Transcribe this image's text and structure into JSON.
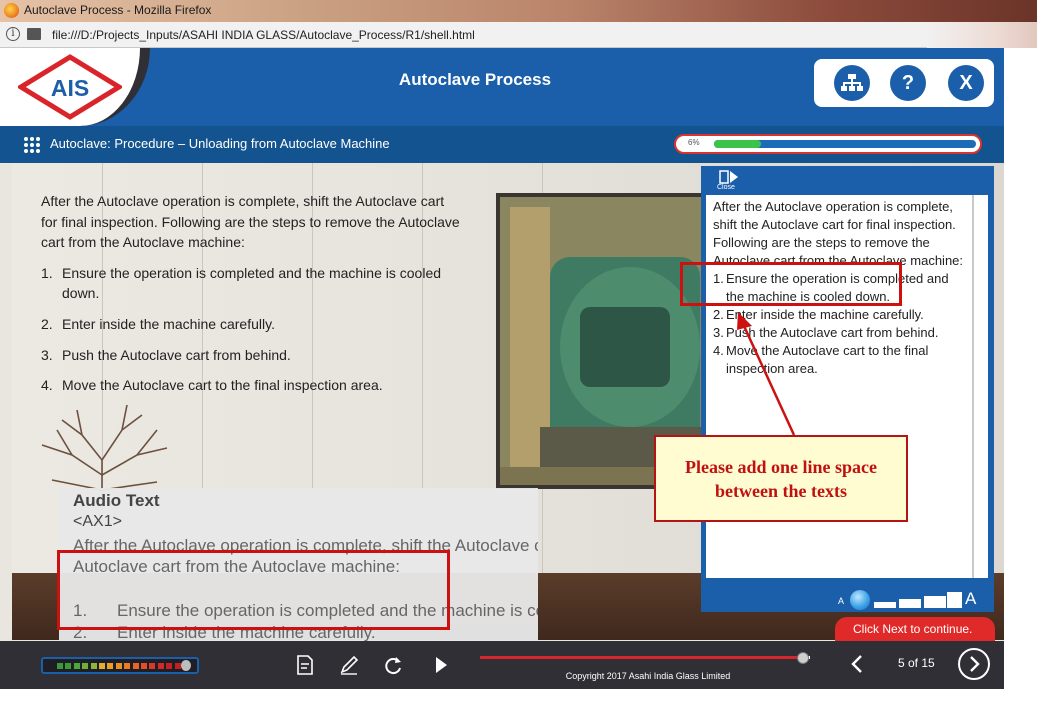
{
  "browser": {
    "window_title": "Autoclave Process - Mozilla Firefox",
    "url": "file:///D:/Projects_Inputs/ASAHI INDIA GLASS/Autoclave_Process/R1/shell.html"
  },
  "header": {
    "logo_text": "AIS",
    "title": "Autoclave Process",
    "close_label": "X",
    "help_label": "?"
  },
  "subheader": {
    "title": "Autoclave: Procedure – Unloading from Autoclave Machine",
    "progress_label": "6%",
    "progress_value": 0.06
  },
  "content": {
    "intro": "After the Autoclave operation is complete, shift the Autoclave cart for final inspection. Following are the steps to remove the Autoclave cart from the Autoclave machine:",
    "steps": [
      {
        "num": "1.",
        "text": "Ensure the operation is completed and the machine is cooled down."
      },
      {
        "num": "2.",
        "text": "Enter inside the machine carefully."
      },
      {
        "num": "3.",
        "text": "Push the Autoclave cart from behind."
      },
      {
        "num": "4.",
        "text": "Move the Autoclave cart to the final inspection area."
      }
    ]
  },
  "transcript": {
    "close_label": "Close",
    "intro": "After the Autoclave operation is complete, shift the Autoclave cart for final inspection. Following are the steps to remove the Autoclave cart from the Autoclave machine:",
    "steps": [
      {
        "num": "1.",
        "text": "Ensure the operation is completed and the machine is cooled down."
      },
      {
        "num": "2.",
        "text": "Enter inside the machine carefully."
      },
      {
        "num": "3.",
        "text": "Push the Autoclave cart from behind."
      },
      {
        "num": "4.",
        "text": "Move the Autoclave cart to the final inspection area."
      }
    ],
    "font_small": "A",
    "font_large": "A"
  },
  "next_tip": "Click Next to continue.",
  "audio_text": {
    "heading": "Audio Text",
    "code": "<AX1>",
    "line1": "After the Autoclave operation is complete, shift the Autoclave cart for final inspection. Following are the steps to remove the",
    "line2": "Autoclave cart from the Autoclave machine:",
    "s1_num": "1.",
    "s1_text": "Ensure the operation is completed and the machine is cooled down.",
    "s2_num": "2.",
    "s2_text": "Enter inside the machine carefully."
  },
  "annotation": {
    "callout": "Please add one line space between the texts",
    "color": "#cc1111"
  },
  "controls": {
    "copyright": "Copyright 2017 Asahi India Glass Limited",
    "page_label": "5 of 15",
    "seek_value": 0.98
  },
  "colors": {
    "brand_blue": "#1b5faa",
    "dark_bar": "#2f2f35",
    "accent_red": "#e02a2a"
  }
}
